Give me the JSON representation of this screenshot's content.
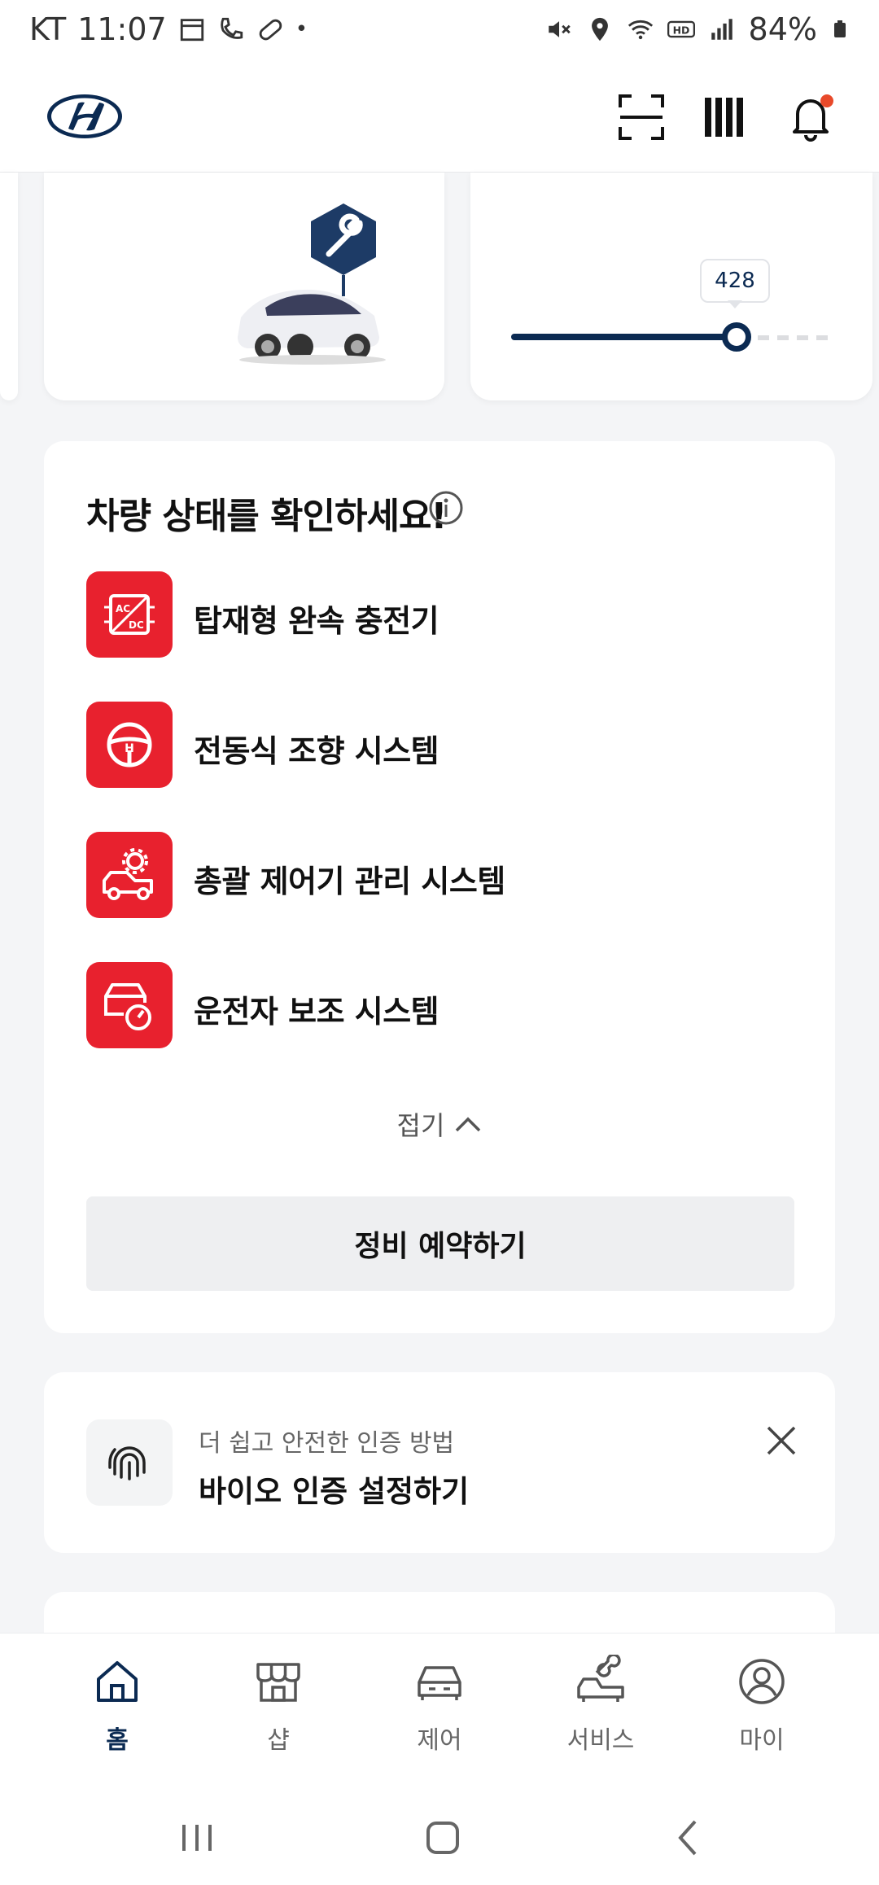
{
  "status_bar": {
    "carrier": "KT",
    "time": "11:07",
    "battery": "84%"
  },
  "header": {
    "brand": "Hyundai"
  },
  "range_widget": {
    "value_label": "428",
    "fill_fraction": 0.71
  },
  "vehicle_status": {
    "title": "차량 상태를 확인하세요!",
    "items": [
      {
        "label": "탑재형 완속 충전기",
        "icon": "ac-dc-charger-icon"
      },
      {
        "label": "전동식 조향 시스템",
        "icon": "steering-wheel-icon"
      },
      {
        "label": "총괄 제어기 관리 시스템",
        "icon": "car-gear-icon"
      },
      {
        "label": "운전자 보조 시스템",
        "icon": "car-gauge-icon"
      }
    ],
    "collapse_label": "접기",
    "reserve_button": "정비 예약하기"
  },
  "bio_auth": {
    "subtitle": "더 쉽고 안전한 인증 방법",
    "title": "바이오 인증 설정하기"
  },
  "bottom_nav": {
    "items": [
      {
        "label": "홈",
        "icon": "home-icon",
        "active": true
      },
      {
        "label": "샵",
        "icon": "shop-icon",
        "active": false
      },
      {
        "label": "제어",
        "icon": "car-icon",
        "active": false
      },
      {
        "label": "서비스",
        "icon": "service-car-wrench-icon",
        "active": false
      },
      {
        "label": "마이",
        "icon": "profile-icon",
        "active": false
      }
    ]
  },
  "colors": {
    "accent_red": "#e8212e",
    "navy": "#0b2a52"
  }
}
